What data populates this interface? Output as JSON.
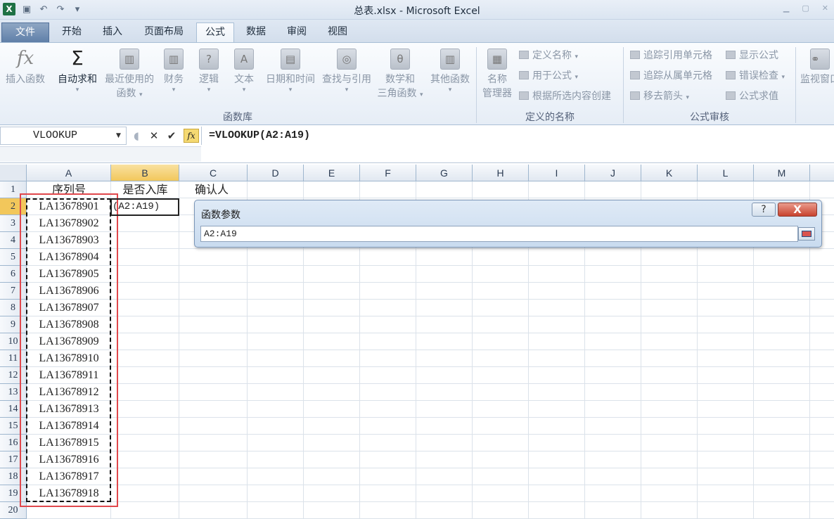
{
  "window": {
    "title": "总表.xlsx - Microsoft Excel"
  },
  "quick_access": {
    "app_icon": "X"
  },
  "tabs": [
    {
      "label": "文件"
    },
    {
      "label": "开始"
    },
    {
      "label": "插入"
    },
    {
      "label": "页面布局"
    },
    {
      "label": "公式"
    },
    {
      "label": "数据"
    },
    {
      "label": "审阅"
    },
    {
      "label": "视图"
    }
  ],
  "ribbon": {
    "function_library": {
      "insert_function": "插入函数",
      "autosum": "自动求和",
      "recent_1": "最近使用的",
      "recent_2": "函数",
      "financial": "财务",
      "logical": "逻辑",
      "text": "文本",
      "datetime": "日期和时间",
      "lookup": "查找与引用",
      "math_1": "数学和",
      "math_2": "三角函数",
      "other": "其他函数",
      "group_label": "函数库"
    },
    "defined_names": {
      "name_manager_1": "名称",
      "name_manager_2": "管理器",
      "define_name": "定义名称",
      "use_in_formula": "用于公式",
      "create_from_selection": "根据所选内容创建",
      "group_label": "定义的名称"
    },
    "formula_auditing": {
      "trace_precedents": "追踪引用单元格",
      "trace_dependents": "追踪从属单元格",
      "remove_arrows": "移去箭头",
      "show_formulas": "显示公式",
      "error_checking": "错误检查",
      "evaluate_formula": "公式求值",
      "group_label": "公式审核"
    },
    "watch_window": "监视窗口"
  },
  "formula_bar": {
    "name_box": "VLOOKUP",
    "fx": "fx",
    "formula": "=VLOOKUP(A2:A19)"
  },
  "grid": {
    "columns": [
      "A",
      "B",
      "C",
      "D",
      "E",
      "F",
      "G",
      "H",
      "I",
      "J",
      "K",
      "L",
      "M"
    ],
    "rows": [
      "1",
      "2",
      "3",
      "4",
      "5",
      "6",
      "7",
      "8",
      "9",
      "10",
      "11",
      "12",
      "13",
      "14",
      "15",
      "16",
      "17",
      "18",
      "19",
      "20"
    ],
    "headers": {
      "A1": "序列号",
      "B1": "是否入库",
      "C1": "确认人"
    },
    "b2_value": "(A2:A19)",
    "serials": [
      "LA13678901",
      "LA13678902",
      "LA13678903",
      "LA13678904",
      "LA13678905",
      "LA13678906",
      "LA13678907",
      "LA13678908",
      "LA13678909",
      "LA13678910",
      "LA13678911",
      "LA13678912",
      "LA13678913",
      "LA13678914",
      "LA13678915",
      "LA13678916",
      "LA13678917",
      "LA13678918"
    ]
  },
  "dialog": {
    "title": "函数参数",
    "help": "?",
    "close": "X",
    "input_value": "A2:A19"
  }
}
